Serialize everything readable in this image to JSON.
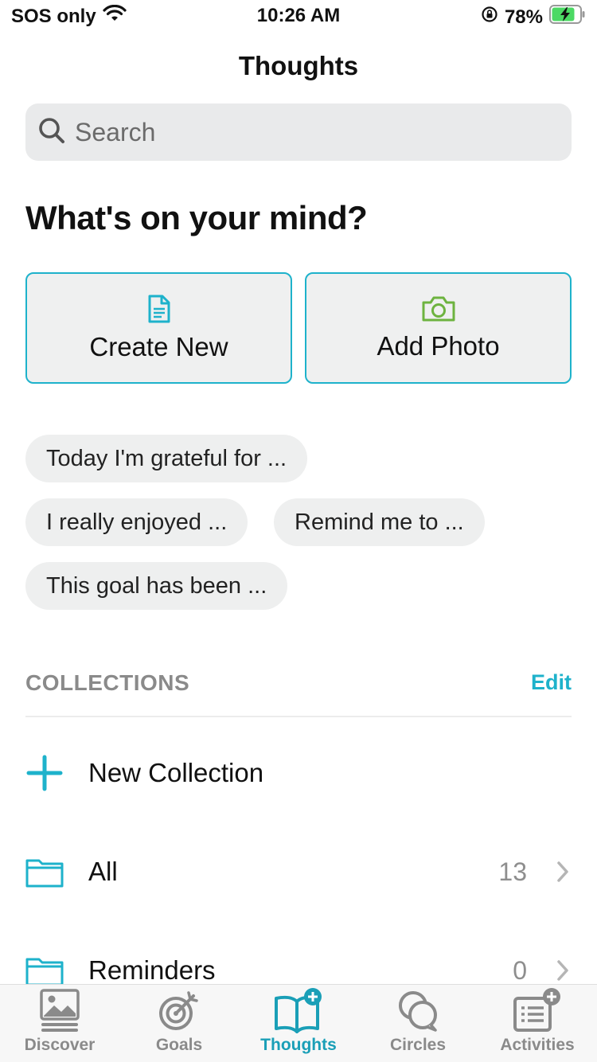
{
  "status_bar": {
    "carrier": "SOS only",
    "time": "10:26 AM",
    "battery": "78%"
  },
  "nav": {
    "title": "Thoughts"
  },
  "search": {
    "placeholder": "Search"
  },
  "prompt": {
    "heading": "What's on your mind?"
  },
  "actions": [
    {
      "label": "Create New",
      "icon": "document-icon"
    },
    {
      "label": "Add Photo",
      "icon": "camera-icon"
    }
  ],
  "suggestions": [
    "Today I'm grateful for ...",
    "I really enjoyed ...",
    "Remind me to ...",
    "This goal has been ..."
  ],
  "collections": {
    "title": "COLLECTIONS",
    "edit_label": "Edit",
    "new_label": "New Collection",
    "items": [
      {
        "label": "All",
        "count": "13"
      },
      {
        "label": "Reminders",
        "count": "0"
      }
    ]
  },
  "tabs": [
    {
      "label": "Discover",
      "icon": "discover-icon",
      "active": false
    },
    {
      "label": "Goals",
      "icon": "target-icon",
      "active": false
    },
    {
      "label": "Thoughts",
      "icon": "book-add-icon",
      "active": true
    },
    {
      "label": "Circles",
      "icon": "chat-bubbles-icon",
      "active": false
    },
    {
      "label": "Activities",
      "icon": "list-add-icon",
      "active": false
    }
  ],
  "colors": {
    "accent": "#1eb2cb",
    "photo_icon": "#6db33f",
    "muted_text": "#8a8a8a",
    "active_tab": "#1a9fb7"
  }
}
